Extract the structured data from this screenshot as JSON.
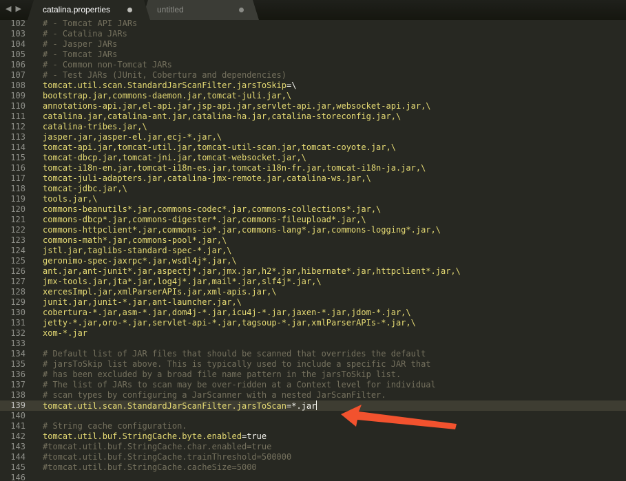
{
  "window": {
    "nav_back": "◀",
    "nav_forward": "▶",
    "tabs": [
      {
        "label": "catalina.properties",
        "active": true,
        "modified": true
      },
      {
        "label": "untitled",
        "active": false,
        "modified": true
      }
    ]
  },
  "editor": {
    "current_line": 139,
    "lines": [
      {
        "n": "102",
        "text": "# - Tomcat API JARs",
        "kind": "comment"
      },
      {
        "n": "103",
        "text": "# - Catalina JARs",
        "kind": "comment"
      },
      {
        "n": "104",
        "text": "# - Jasper JARs",
        "kind": "comment"
      },
      {
        "n": "105",
        "text": "# - Tomcat JARs",
        "kind": "comment"
      },
      {
        "n": "106",
        "text": "# - Common non-Tomcat JARs",
        "kind": "comment"
      },
      {
        "n": "107",
        "text": "# - Test JARs (JUnit, Cobertura and dependencies)",
        "kind": "comment"
      },
      {
        "n": "108",
        "key": "tomcat.util.scan.StandardJarScanFilter.jarsToSkip",
        "eq": "=",
        "value": "\\",
        "kind": "prop"
      },
      {
        "n": "109",
        "text": "bootstrap.jar,commons-daemon.jar,tomcat-juli.jar,\\",
        "kind": "plain"
      },
      {
        "n": "110",
        "text": "annotations-api.jar,el-api.jar,jsp-api.jar,servlet-api.jar,websocket-api.jar,\\",
        "kind": "plain"
      },
      {
        "n": "111",
        "text": "catalina.jar,catalina-ant.jar,catalina-ha.jar,catalina-storeconfig.jar,\\",
        "kind": "plain"
      },
      {
        "n": "112",
        "text": "catalina-tribes.jar,\\",
        "kind": "plain"
      },
      {
        "n": "113",
        "text": "jasper.jar,jasper-el.jar,ecj-*.jar,\\",
        "kind": "plain"
      },
      {
        "n": "114",
        "text": "tomcat-api.jar,tomcat-util.jar,tomcat-util-scan.jar,tomcat-coyote.jar,\\",
        "kind": "plain"
      },
      {
        "n": "115",
        "text": "tomcat-dbcp.jar,tomcat-jni.jar,tomcat-websocket.jar,\\",
        "kind": "plain"
      },
      {
        "n": "116",
        "text": "tomcat-i18n-en.jar,tomcat-i18n-es.jar,tomcat-i18n-fr.jar,tomcat-i18n-ja.jar,\\",
        "kind": "plain"
      },
      {
        "n": "117",
        "text": "tomcat-juli-adapters.jar,catalina-jmx-remote.jar,catalina-ws.jar,\\",
        "kind": "plain"
      },
      {
        "n": "118",
        "text": "tomcat-jdbc.jar,\\",
        "kind": "plain"
      },
      {
        "n": "119",
        "text": "tools.jar,\\",
        "kind": "plain"
      },
      {
        "n": "120",
        "text": "commons-beanutils*.jar,commons-codec*.jar,commons-collections*.jar,\\",
        "kind": "plain"
      },
      {
        "n": "121",
        "text": "commons-dbcp*.jar,commons-digester*.jar,commons-fileupload*.jar,\\",
        "kind": "plain"
      },
      {
        "n": "122",
        "text": "commons-httpclient*.jar,commons-io*.jar,commons-lang*.jar,commons-logging*.jar,\\",
        "kind": "plain"
      },
      {
        "n": "123",
        "text": "commons-math*.jar,commons-pool*.jar,\\",
        "kind": "plain"
      },
      {
        "n": "124",
        "text": "jstl.jar,taglibs-standard-spec-*.jar,\\",
        "kind": "plain"
      },
      {
        "n": "125",
        "text": "geronimo-spec-jaxrpc*.jar,wsdl4j*.jar,\\",
        "kind": "plain"
      },
      {
        "n": "126",
        "text": "ant.jar,ant-junit*.jar,aspectj*.jar,jmx.jar,h2*.jar,hibernate*.jar,httpclient*.jar,\\",
        "kind": "plain"
      },
      {
        "n": "127",
        "text": "jmx-tools.jar,jta*.jar,log4j*.jar,mail*.jar,slf4j*.jar,\\",
        "kind": "plain"
      },
      {
        "n": "128",
        "text": "xercesImpl.jar,xmlParserAPIs.jar,xml-apis.jar,\\",
        "kind": "plain"
      },
      {
        "n": "129",
        "text": "junit.jar,junit-*.jar,ant-launcher.jar,\\",
        "kind": "plain"
      },
      {
        "n": "130",
        "text": "cobertura-*.jar,asm-*.jar,dom4j-*.jar,icu4j-*.jar,jaxen-*.jar,jdom-*.jar,\\",
        "kind": "plain"
      },
      {
        "n": "131",
        "text": "jetty-*.jar,oro-*.jar,servlet-api-*.jar,tagsoup-*.jar,xmlParserAPIs-*.jar,\\",
        "kind": "plain"
      },
      {
        "n": "132",
        "text": "xom-*.jar",
        "kind": "plain"
      },
      {
        "n": "133",
        "text": "",
        "kind": "plain"
      },
      {
        "n": "134",
        "text": "# Default list of JAR files that should be scanned that overrides the default",
        "kind": "comment"
      },
      {
        "n": "135",
        "text": "# jarsToSkip list above. This is typically used to include a specific JAR that",
        "kind": "comment"
      },
      {
        "n": "136",
        "text": "# has been excluded by a broad file name pattern in the jarsToSkip list.",
        "kind": "comment"
      },
      {
        "n": "137",
        "text": "# The list of JARs to scan may be over-ridden at a Context level for individual",
        "kind": "comment"
      },
      {
        "n": "138",
        "text": "# scan types by configuring a JarScanner with a nested JarScanFilter.",
        "kind": "comment"
      },
      {
        "n": "139",
        "key": "tomcat.util.scan.StandardJarScanFilter.jarsToScan",
        "eq": "=",
        "value": "*.jar",
        "kind": "prop",
        "cursor": true
      },
      {
        "n": "140",
        "text": "",
        "kind": "plain"
      },
      {
        "n": "141",
        "text": "# String cache configuration.",
        "kind": "comment"
      },
      {
        "n": "142",
        "key": "tomcat.util.buf.StringCache.byte.enabled",
        "eq": "=",
        "value": "true",
        "kind": "prop"
      },
      {
        "n": "143",
        "text": "#tomcat.util.buf.StringCache.char.enabled=true",
        "kind": "comment"
      },
      {
        "n": "144",
        "text": "#tomcat.util.buf.StringCache.trainThreshold=500000",
        "kind": "comment"
      },
      {
        "n": "145",
        "text": "#tomcat.util.buf.StringCache.cacheSize=5000",
        "kind": "comment"
      },
      {
        "n": "146",
        "text": "",
        "kind": "plain"
      }
    ]
  },
  "annotation": {
    "arrow_color": "#f2522e"
  }
}
